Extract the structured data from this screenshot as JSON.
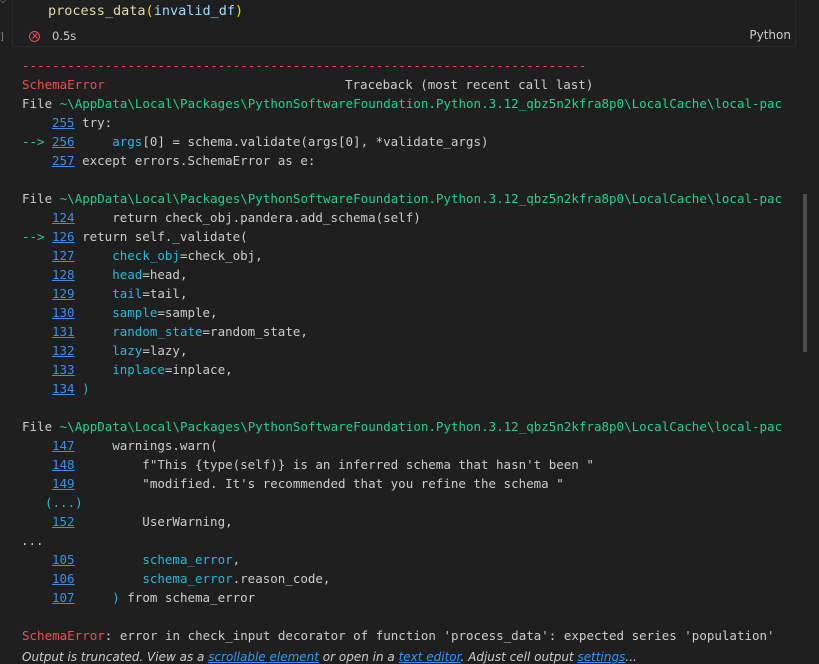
{
  "cell": {
    "code": {
      "fn": "process_data",
      "open": "(",
      "arg": "invalid_df",
      "close": ")"
    },
    "exec_time": "0.5s",
    "language": "Python",
    "gutter": "]"
  },
  "output": {
    "separator": "---------------------------------------------------------------------------",
    "error_name": "SchemaError",
    "traceback_header": "Traceback (most recent call last)",
    "file_prefix": "File ",
    "file_path": "~\\AppData\\Local\\Packages\\PythonSoftwareFoundation.Python.3.12_qbz5n2kfra8p0\\LocalCache\\local-pac",
    "frame1": [
      {
        "num": "255",
        "arrow": "",
        "pre": " try:",
        "cyan": "",
        "post": ""
      },
      {
        "num": "256",
        "arrow": "--> ",
        "pre": "     ",
        "cyan": "args",
        "post": "[0] = schema.validate(args[0], *validate_args)"
      },
      {
        "num": "257",
        "arrow": "",
        "pre": " except errors.SchemaError as e:",
        "cyan": "",
        "post": ""
      }
    ],
    "frame2": [
      {
        "num": "124",
        "arrow": "",
        "pre": "     return check_obj.pandera.add_schema(self)",
        "cyan": "",
        "post": ""
      },
      {
        "num": "126",
        "arrow": "--> ",
        "pre": " return self._validate(",
        "cyan": "",
        "post": ""
      },
      {
        "num": "127",
        "arrow": "",
        "pre": "     ",
        "cyan": "check_obj",
        "post": "=check_obj,"
      },
      {
        "num": "128",
        "arrow": "",
        "pre": "     ",
        "cyan": "head",
        "post": "=head,"
      },
      {
        "num": "129",
        "arrow": "",
        "pre": "     ",
        "cyan": "tail",
        "post": "=tail,"
      },
      {
        "num": "130",
        "arrow": "",
        "pre": "     ",
        "cyan": "sample",
        "post": "=sample,"
      },
      {
        "num": "131",
        "arrow": "",
        "pre": "     ",
        "cyan": "random_state",
        "post": "=random_state,"
      },
      {
        "num": "132",
        "arrow": "",
        "pre": "     ",
        "cyan": "lazy",
        "post": "=lazy,"
      },
      {
        "num": "133",
        "arrow": "",
        "pre": "     ",
        "cyan": "inplace",
        "post": "=inplace,"
      },
      {
        "num": "134",
        "arrow": "",
        "pre": " ",
        "cyan": ")",
        "post": ""
      }
    ],
    "frame3": [
      {
        "num": "147",
        "arrow": "",
        "pre": "     warnings.warn(",
        "cyan": "",
        "post": ""
      },
      {
        "num": "148",
        "arrow": "",
        "pre": "         f\"This {type(self)} is an inferred schema that hasn't been \"",
        "cyan": "",
        "post": ""
      },
      {
        "num": "149",
        "arrow": "",
        "pre": "         \"modified. It's recommended that you refine the schema \"",
        "cyan": "",
        "post": ""
      }
    ],
    "ellipsis_paren": "(...)",
    "frame3b": [
      {
        "num": "152",
        "arrow": "",
        "pre": "         UserWarning,",
        "cyan": "",
        "post": ""
      }
    ],
    "dots": "...",
    "frame4": [
      {
        "num": "105",
        "arrow": "",
        "pre": "         ",
        "cyan": "schema_error",
        "post": ","
      },
      {
        "num": "106",
        "arrow": "",
        "pre": "         ",
        "cyan": "schema_error",
        "post": ".reason_code,"
      },
      {
        "num": "107",
        "arrow": "",
        "pre": "     ",
        "cyan": ")",
        "post": " from schema_error"
      }
    ],
    "final_error_name": "SchemaError",
    "final_message": ": error in check_input decorator of function 'process_data': expected series 'population'"
  },
  "truncation": {
    "text1": "Output is truncated. View as a ",
    "link1": "scrollable element",
    "text2": " or open in a ",
    "link2": "text editor",
    "text3": ". Adjust cell output ",
    "link3": "settings",
    "text4": "..."
  }
}
